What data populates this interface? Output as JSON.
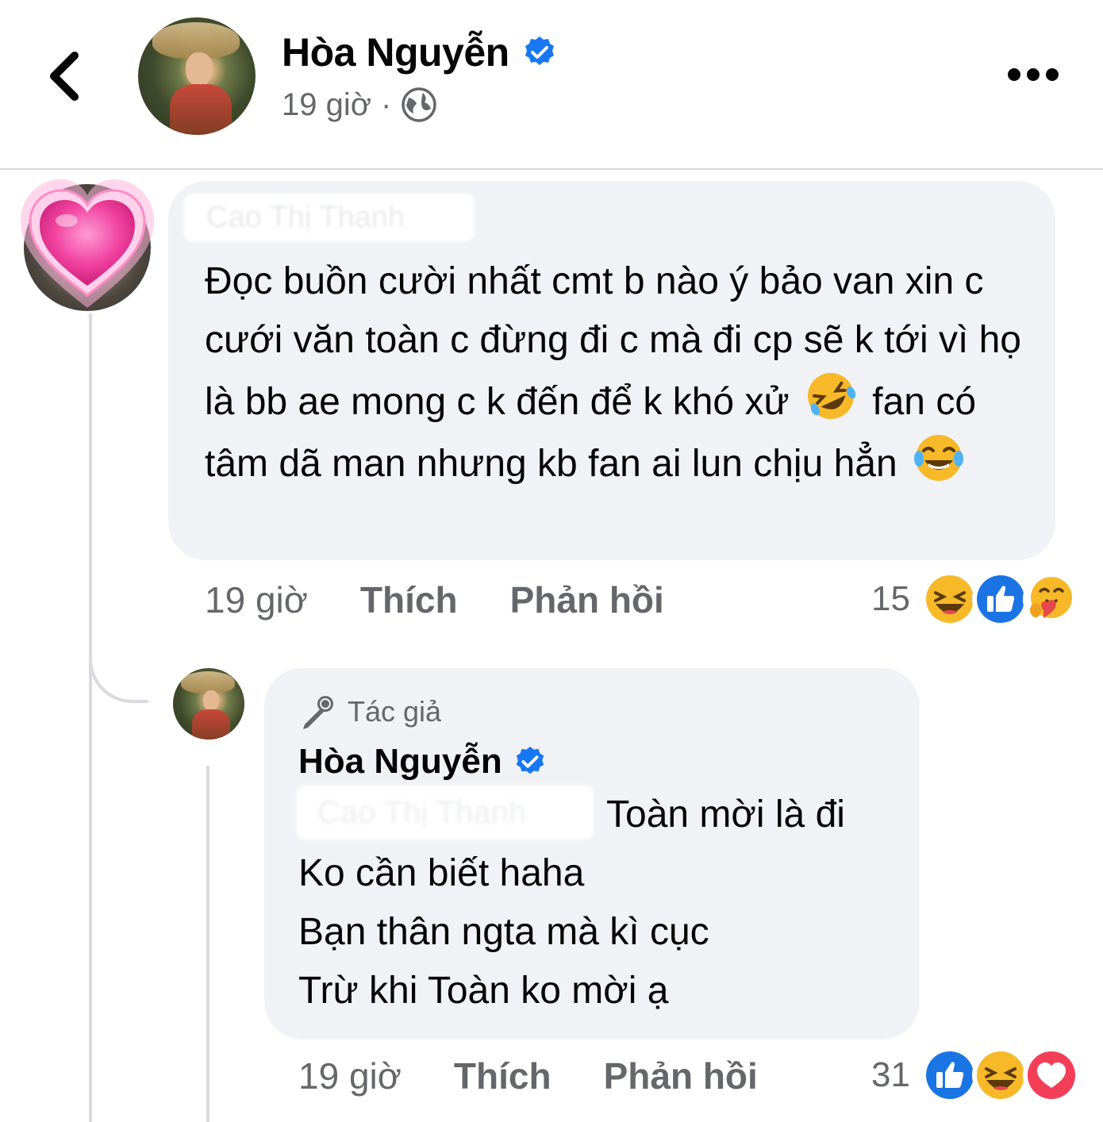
{
  "header": {
    "author_name": "Hòa Nguyễn",
    "time": "19 giờ",
    "separator": "·",
    "icons": {
      "back": "chevron-left-icon",
      "verified": "verified-badge-icon",
      "privacy": "globe-icon",
      "more": "more-dots-icon"
    }
  },
  "comment": {
    "author_name_blurred": "Cao Thị Thanh",
    "text_parts": [
      "Đọc buồn cười nhất cmt b nào ý bảo van xin c cưới văn toàn c đừng đi c mà đi cp sẽ k tới vì họ là bb ae mong c k đến để k khó xử",
      "fan có tâm dã man nhưng kb fan ai lun chịu hẳn"
    ],
    "emojis": [
      "rolling-laughing-emoji",
      "tears-of-joy-emoji"
    ],
    "time": "19 giờ",
    "like_label": "Thích",
    "reply_label": "Phản hồi",
    "reaction_count": "15",
    "reactions": [
      "haha-reaction-icon",
      "like-reaction-icon",
      "care-reaction-icon"
    ],
    "avatar_overlay": "heart-sticker-icon"
  },
  "reply": {
    "author_badge": "Tác giả",
    "author_name": "Hòa Nguyễn",
    "mention_blurred": "Cao Thị Thanh",
    "lines": [
      "Toàn mời là đi",
      "Ko cần biết haha",
      "Bạn thân ngta mà kì cục",
      "Trừ khi Toàn ko mời ạ"
    ],
    "time": "19 giờ",
    "like_label": "Thích",
    "reply_label": "Phản hồi",
    "reaction_count": "31",
    "reactions": [
      "like-reaction-icon",
      "haha-reaction-icon",
      "love-reaction-icon"
    ]
  },
  "colors": {
    "primary_text": "#050505",
    "secondary_text": "#65676b",
    "bubble_bg": "#f0f2f5",
    "verified_blue": "#1877f2",
    "divider": "#d6d8dc"
  }
}
